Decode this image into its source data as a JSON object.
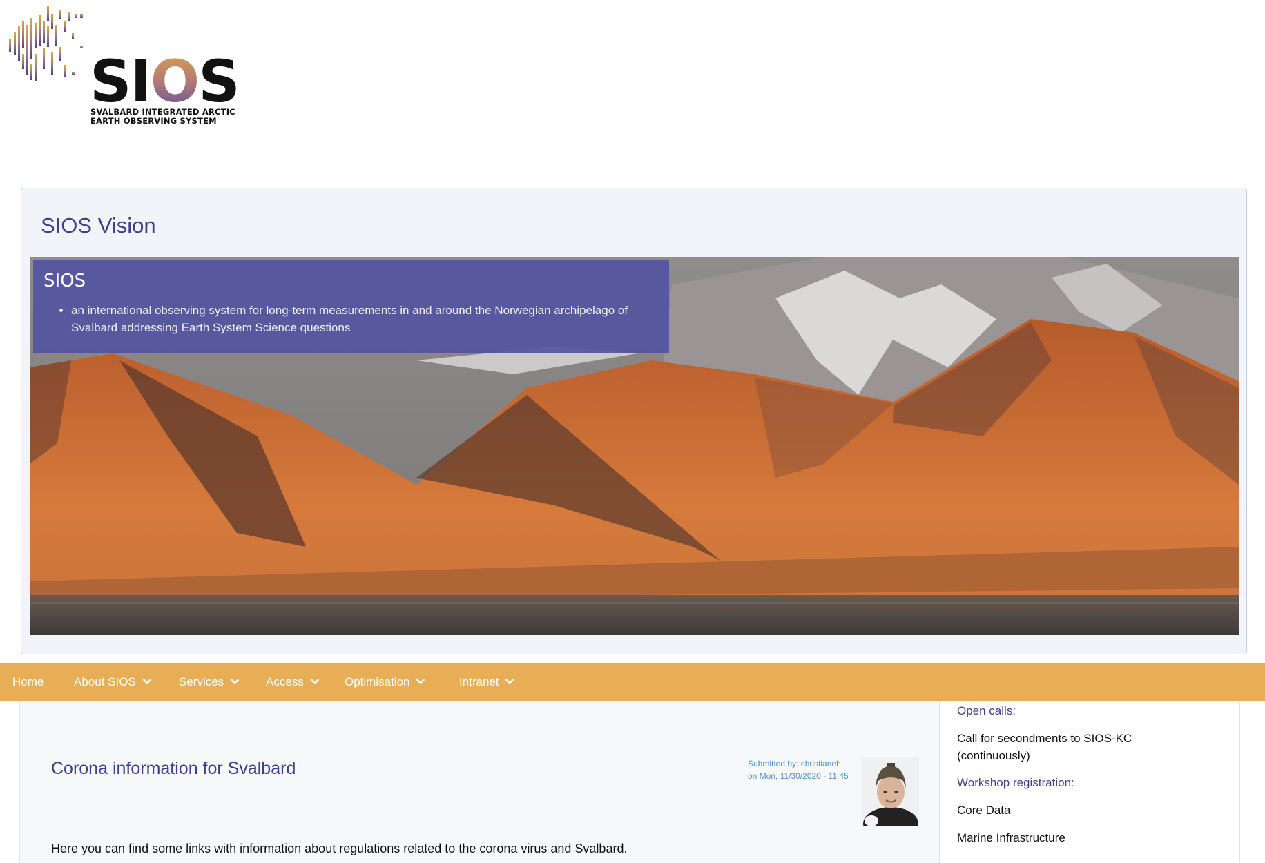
{
  "logo": {
    "wordmark": "SIOS",
    "subtitle_line1": "SVALBARD INTEGRATED ARCTIC",
    "subtitle_line2": "EARTH OBSERVING SYSTEM"
  },
  "vision": {
    "title": "SIOS Vision",
    "hero_caption": {
      "heading": "SIOS",
      "bullet": "an international observing system for long-term measurements in and around the Norwegian archipelago of Svalbard addressing Earth System Science questions"
    }
  },
  "nav": {
    "items": [
      {
        "label": "Home"
      },
      {
        "label": "About SIOS"
      },
      {
        "label": "Services"
      },
      {
        "label": "Access"
      },
      {
        "label": "Optimisation"
      },
      {
        "label": "Intranet"
      }
    ]
  },
  "article": {
    "title": "Corona information for Svalbard",
    "submitted_by": "Submitted by: christianeh",
    "submitted_on": "on Mon, 11/30/2020 - 11:45",
    "body": "Here you can find some links with information about regulations related to the corona virus and Svalbard."
  },
  "sidebar": {
    "open_calls_heading": "Open calls:",
    "open_call_1": "Call for secondments to SIOS-KC (continuously)",
    "workshop_heading": "Workshop registration:",
    "workshop_1": "Core Data",
    "workshop_2": "Marine Infrastructure"
  },
  "colors": {
    "accent_purple": "#3d3f8f",
    "nav_orange": "#e8ae56",
    "caption_overlay": "#5454a0",
    "link_blue": "#4d8fd6"
  }
}
